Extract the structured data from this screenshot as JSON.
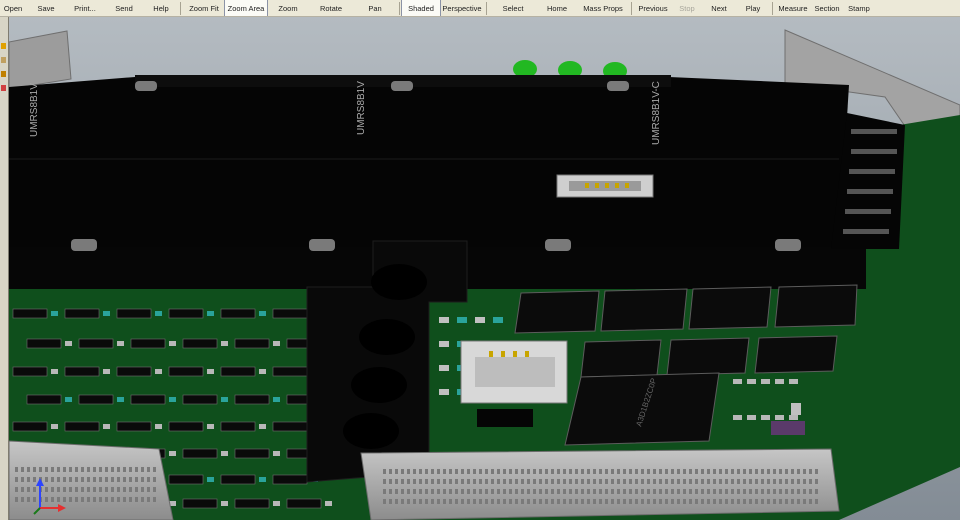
{
  "toolbar": {
    "buttons": [
      {
        "id": "open",
        "label": "Open"
      },
      {
        "id": "save",
        "label": "Save"
      },
      {
        "id": "print",
        "label": "Print..."
      },
      {
        "id": "send",
        "label": "Send"
      },
      {
        "id": "help",
        "label": "Help"
      },
      {
        "id": "zoom_fit",
        "label": "Zoom Fit"
      },
      {
        "id": "zoom_area",
        "label": "Zoom Area"
      },
      {
        "id": "zoom",
        "label": "Zoom"
      },
      {
        "id": "rotate",
        "label": "Rotate"
      },
      {
        "id": "pan",
        "label": "Pan"
      },
      {
        "id": "shaded",
        "label": "Shaded"
      },
      {
        "id": "perspective",
        "label": "Perspective"
      },
      {
        "id": "select",
        "label": "Select"
      },
      {
        "id": "home",
        "label": "Home"
      },
      {
        "id": "mass_props",
        "label": "Mass Props"
      },
      {
        "id": "previous",
        "label": "Previous"
      },
      {
        "id": "stop",
        "label": "Stop"
      },
      {
        "id": "next",
        "label": "Next"
      },
      {
        "id": "play",
        "label": "Play"
      },
      {
        "id": "measure",
        "label": "Measure"
      },
      {
        "id": "section",
        "label": "Section"
      },
      {
        "id": "stamp",
        "label": "Stamp"
      }
    ]
  },
  "model": {
    "module_labels": [
      "UMRS8B1V",
      "UMRS8B1V",
      "UMRS8B1V-C"
    ],
    "chip_label": "A3D1B2ZC0P",
    "colors": {
      "background": "#9aa3ab",
      "pcb": "#0f4f1c",
      "module_black": "#050505",
      "connector_gray": "#a9a9a9",
      "led_green": "#22b822"
    }
  }
}
